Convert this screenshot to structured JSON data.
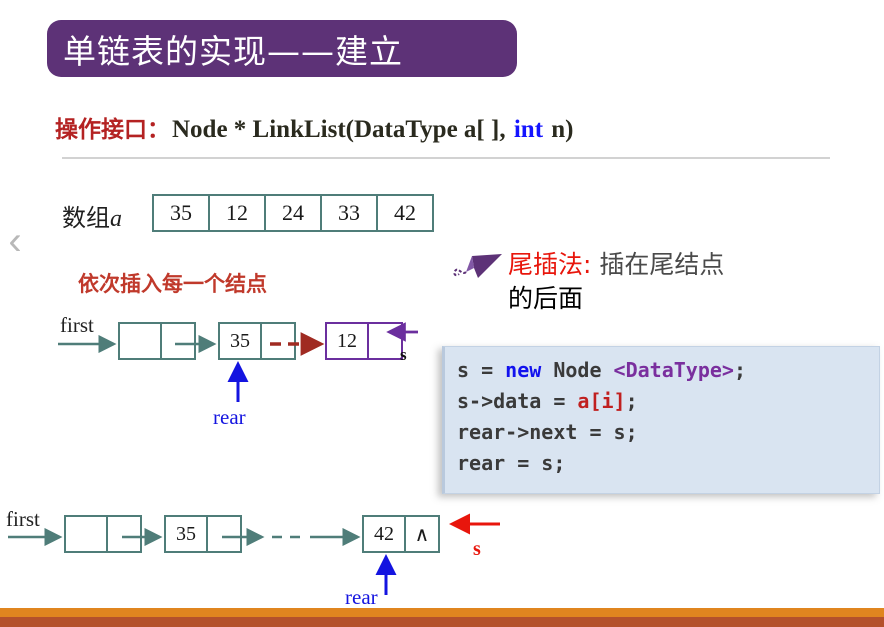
{
  "slide": {
    "title": "单链表的实现——建立",
    "nav_prev_icon": "chevron-left-icon"
  },
  "operation": {
    "label": "操作接口：",
    "signature_part1": "Node * LinkList(DataType a[ ], ",
    "keyword": "int",
    "signature_part2": " n)"
  },
  "array": {
    "label_cn": "数组",
    "label_var": "a",
    "values": [
      "35",
      "12",
      "24",
      "33",
      "42"
    ]
  },
  "note": {
    "insert_each_node": "依次插入每一个结点"
  },
  "callout": {
    "icon": "paper-plane-icon",
    "highlight": "尾插法:",
    "rest_line1": " 插在尾结点",
    "rest_line2": "的后面"
  },
  "code": {
    "line1_a": "s = ",
    "line1_kw": "new",
    "line1_b": " Node ",
    "line1_type": "<DataType>",
    "line1_c": ";",
    "line2_a": "s->data = ",
    "line2_arr": "a[i]",
    "line2_b": ";",
    "line3": "rear->next = s;",
    "line4": "rear = s;"
  },
  "diagram_top": {
    "first_label": "first",
    "head_node_data": "",
    "head_node_next": "",
    "node1_data": "35",
    "node2_data": "12",
    "s_label": "s",
    "rear_label": "rear"
  },
  "diagram_bottom": {
    "first_label": "first",
    "head_node_data": "",
    "node1_data": "35",
    "last_node_data": "42",
    "last_node_null": "∧",
    "s_label": "s",
    "rear_label": "rear"
  },
  "colors": {
    "title_banner": "#5d3277",
    "heading_red": "#b42222",
    "teal": "#4f7d79",
    "purple": "#6b2f9e",
    "blue": "#1414e0",
    "dark_red": "#8d2a20",
    "code_bg": "#d9e4f1",
    "bar_orange": "#e0851f",
    "bar_red": "#b4512b"
  }
}
